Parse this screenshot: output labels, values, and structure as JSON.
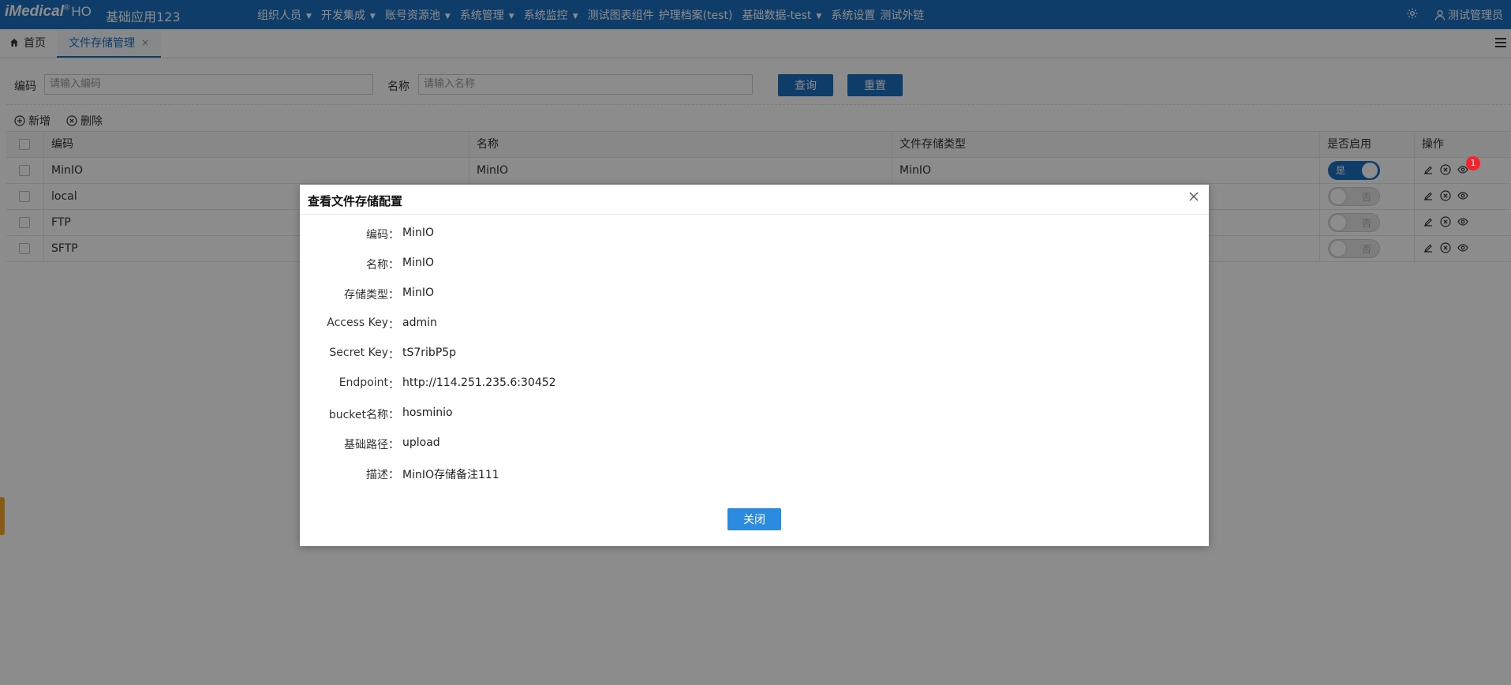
{
  "header": {
    "logo_main": "iMedical",
    "logo_reg": "®",
    "logo_suffix": "HO",
    "app_name": "基础应用123",
    "nav": [
      {
        "label": "组织人员",
        "dropdown": true
      },
      {
        "label": "开发集成",
        "dropdown": true
      },
      {
        "label": "账号资源池",
        "dropdown": true
      },
      {
        "label": "系统管理",
        "dropdown": true
      },
      {
        "label": "系统监控",
        "dropdown": true
      },
      {
        "label": "测试图表组件",
        "dropdown": false
      },
      {
        "label": "护理档案(test)",
        "dropdown": false
      },
      {
        "label": "基础数据-test",
        "dropdown": true
      },
      {
        "label": "系统设置",
        "dropdown": false
      },
      {
        "label": "测试外链",
        "dropdown": false
      }
    ],
    "user_name": "测试管理员",
    "settings_icon": "gear-icon",
    "user_icon": "user-icon"
  },
  "tabs": {
    "home": "首页",
    "active": "文件存储管理",
    "close_glyph": "×"
  },
  "search": {
    "code_label": "编码",
    "code_placeholder": "请输入编码",
    "name_label": "名称",
    "name_placeholder": "请输入名称",
    "query_button": "查询",
    "reset_button": "重置"
  },
  "toolbar": {
    "add_label": "新增",
    "delete_label": "删除"
  },
  "table": {
    "columns": [
      "编码",
      "名称",
      "文件存储类型",
      "是否启用",
      "操作"
    ],
    "rows": [
      {
        "code": "MinIO",
        "name": "MinIO",
        "type": "MinIO",
        "enabled": true
      },
      {
        "code": "local",
        "name": "",
        "type": "",
        "enabled": false
      },
      {
        "code": "FTP",
        "name": "",
        "type": "",
        "enabled": false
      },
      {
        "code": "SFTP",
        "name": "",
        "type": "",
        "enabled": false
      }
    ],
    "switch_on_text": "是",
    "switch_off_text": "否",
    "badge_count": "1"
  },
  "modal": {
    "title": "查看文件存储配置",
    "fields": [
      {
        "label": "编码",
        "value": "MinIO"
      },
      {
        "label": "名称",
        "value": "MinIO"
      },
      {
        "label": "存储类型",
        "value": "MinIO"
      },
      {
        "label": "Access Key",
        "value": "admin"
      },
      {
        "label": "Secret Key",
        "value": "tS7ribP5p"
      },
      {
        "label": "Endpoint",
        "value": "http://114.251.235.6:30452"
      },
      {
        "label": "bucket名称",
        "value": "hosminio"
      },
      {
        "label": "基础路径",
        "value": "upload"
      },
      {
        "label": "描述",
        "value": "MinIO存储备注111"
      }
    ],
    "colon": "：",
    "close_button": "关闭"
  },
  "colors": {
    "primary": "#1c6fbf",
    "modal_button": "#2b8be0",
    "badge": "#f5222d"
  }
}
